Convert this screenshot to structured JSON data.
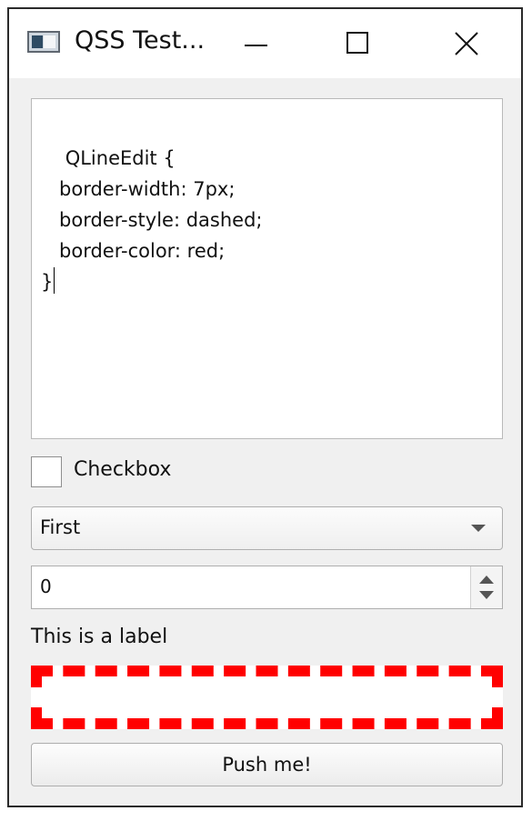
{
  "window": {
    "title": "QSS Test..."
  },
  "editor": {
    "code": "QLineEdit {\n   border-width: 7px;\n   border-style: dashed;\n   border-color: red;\n}"
  },
  "checkbox": {
    "label": "Checkbox",
    "checked": false
  },
  "combobox": {
    "selected": "First"
  },
  "spinbox": {
    "value": "0"
  },
  "label": {
    "text": "This is a label"
  },
  "line_edit": {
    "value": "",
    "border_color": "#ff0000",
    "border_style": "dashed"
  },
  "button": {
    "label": "Push me!"
  },
  "colors": {
    "window_bg": "#f0f0f0",
    "titlebar_bg": "#ffffff",
    "accent_red": "#ff0000"
  }
}
